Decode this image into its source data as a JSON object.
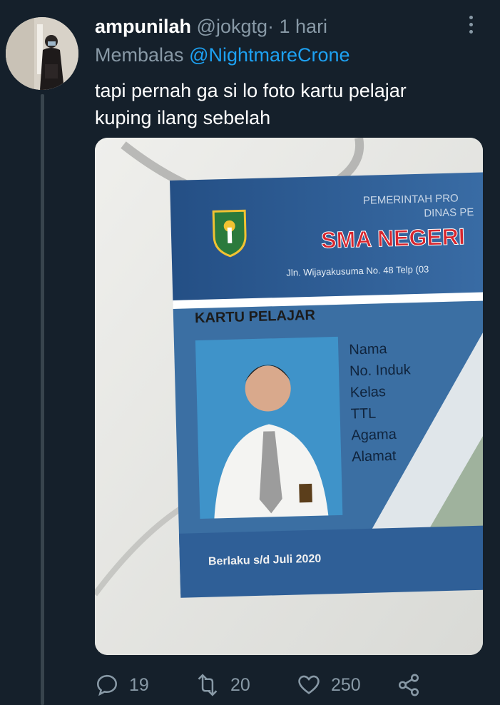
{
  "tweet": {
    "display_name": "ampunilah",
    "handle": "@jokgtg",
    "separator": "·",
    "time": "1 hari",
    "reply_prefix": "Membalas",
    "reply_to": "@NightmareCrone",
    "text_lines": [
      "tapi pernah ga si lo foto kartu pelajar",
      "kuping ilang sebelah"
    ]
  },
  "media": {
    "card": {
      "gov_line1": "PEMERINTAH PRO",
      "gov_line2": "DINAS PE",
      "school": "SMA NEGERI",
      "address": "Jln. Wijayakusuma No. 48 Telp (03",
      "card_title": "KARTU PELAJAR",
      "fields": [
        "Nama",
        "No. Induk",
        "Kelas",
        "TTL",
        "Agama",
        "Alamat"
      ],
      "validity": "Berlaku s/d Juli 2020"
    }
  },
  "actions": {
    "replies": "19",
    "retweets": "20",
    "likes": "250"
  },
  "icons": [
    "more-icon",
    "reply-icon",
    "retweet-icon",
    "like-icon",
    "share-icon"
  ],
  "colors": {
    "background": "#15202b",
    "secondary_text": "#8899a6",
    "link": "#1da1f2",
    "thread_line": "#38444d",
    "card_blue": "#2f5f97"
  }
}
